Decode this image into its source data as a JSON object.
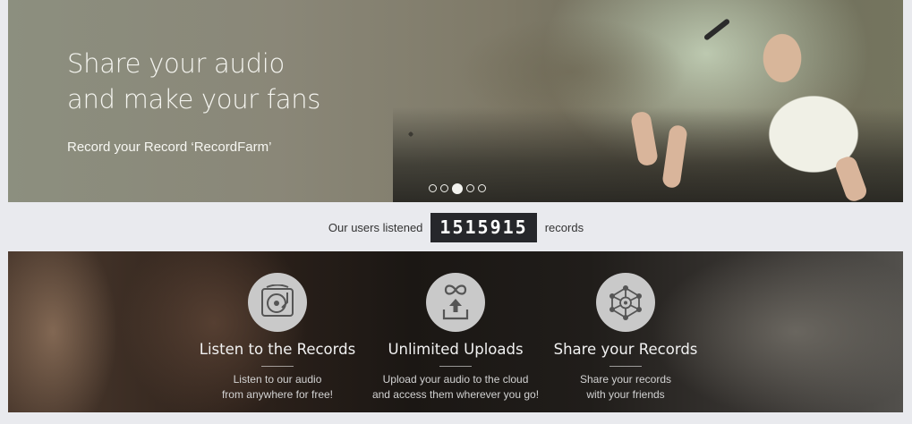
{
  "hero": {
    "title_line1": "Share your audio",
    "title_line2": "and make your fans",
    "subtitle": "Record your Record ‘RecordFarm’",
    "slides": 5,
    "active_slide": 3
  },
  "counter": {
    "prefix": "Our users listened",
    "value": "1515915",
    "suffix": "records"
  },
  "features": [
    {
      "icon": "turntable-icon",
      "title": "Listen to the Records",
      "desc_line1": "Listen to our audio",
      "desc_line2": "from anywhere for free!"
    },
    {
      "icon": "upload-infinity-icon",
      "title": "Unlimited Uploads",
      "desc_line1": "Upload your audio to the cloud",
      "desc_line2": "and access them wherever you go!"
    },
    {
      "icon": "share-network-icon",
      "title": "Share your Records",
      "desc_line1": "Share your records",
      "desc_line2": "with your friends"
    }
  ],
  "colors": {
    "background": "#e9eaee",
    "counter_bg": "#26272b",
    "icon_circle": "#c9c9c9",
    "icon_glyph": "#555555"
  }
}
